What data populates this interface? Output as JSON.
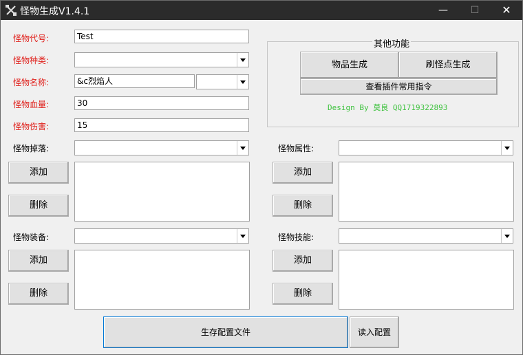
{
  "window": {
    "title": "怪物生成V1.4.1",
    "controls": {
      "minimize": "—",
      "maximize": "☐",
      "close": "✕"
    }
  },
  "form": {
    "code_label": "怪物代号:",
    "code_value": "Test",
    "type_label": "怪物种类:",
    "type_value": "",
    "name_label": "怪物名称:",
    "name_value": "&c烈焰人",
    "name_color_value": "",
    "hp_label": "怪物血量:",
    "hp_value": "30",
    "damage_label": "怪物伤害:",
    "damage_value": "15"
  },
  "other": {
    "group_title": "其他功能",
    "item_button": "物品生成",
    "spawn_button": "刷怪点生成",
    "commands_button": "查看插件常用指令",
    "design_text": "Design By 莫良 QQ1719322893"
  },
  "drops": {
    "label": "怪物掉落:",
    "add": "添加",
    "remove": "删除"
  },
  "attributes": {
    "label": "怪物属性:",
    "add": "添加",
    "remove": "删除"
  },
  "equipment": {
    "label": "怪物装备:",
    "add": "添加",
    "remove": "删除"
  },
  "skills": {
    "label": "怪物技能:",
    "add": "添加",
    "remove": "删除"
  },
  "footer": {
    "save_button": "生存配置文件",
    "load_button": "读入配置"
  },
  "colors": {
    "required_label": "#e0201b",
    "design_text": "#3ec23e",
    "titlebar": "#2b2b2b"
  }
}
